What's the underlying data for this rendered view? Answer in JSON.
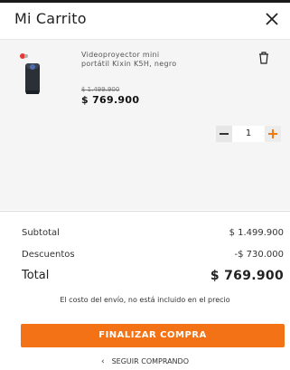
{
  "header": {
    "title": "Mi Carrito"
  },
  "product": {
    "name": "Videoproyector mini portátil Kixin K5H, negro",
    "old_price": "$ 1.499.900",
    "price": "$ 769.900",
    "quantity": "1"
  },
  "summary": {
    "subtotal_label": "Subtotal",
    "subtotal_value": "$ 1.499.900",
    "discount_label": "Descuentos",
    "discount_value": "-$ 730.000",
    "total_label": "Total",
    "total_value": "$ 769.900"
  },
  "shipping_note": "El costo del envío, no está incluido en el precio",
  "actions": {
    "checkout_label": "FINALIZAR COMPRA",
    "continue_label": "SEGUIR COMPRANDO"
  },
  "colors": {
    "accent": "#f47216",
    "panel": "#f5f5f5"
  },
  "icons": [
    "close-icon",
    "trash-icon",
    "minus-icon",
    "plus-icon",
    "chevron-left-icon"
  ]
}
